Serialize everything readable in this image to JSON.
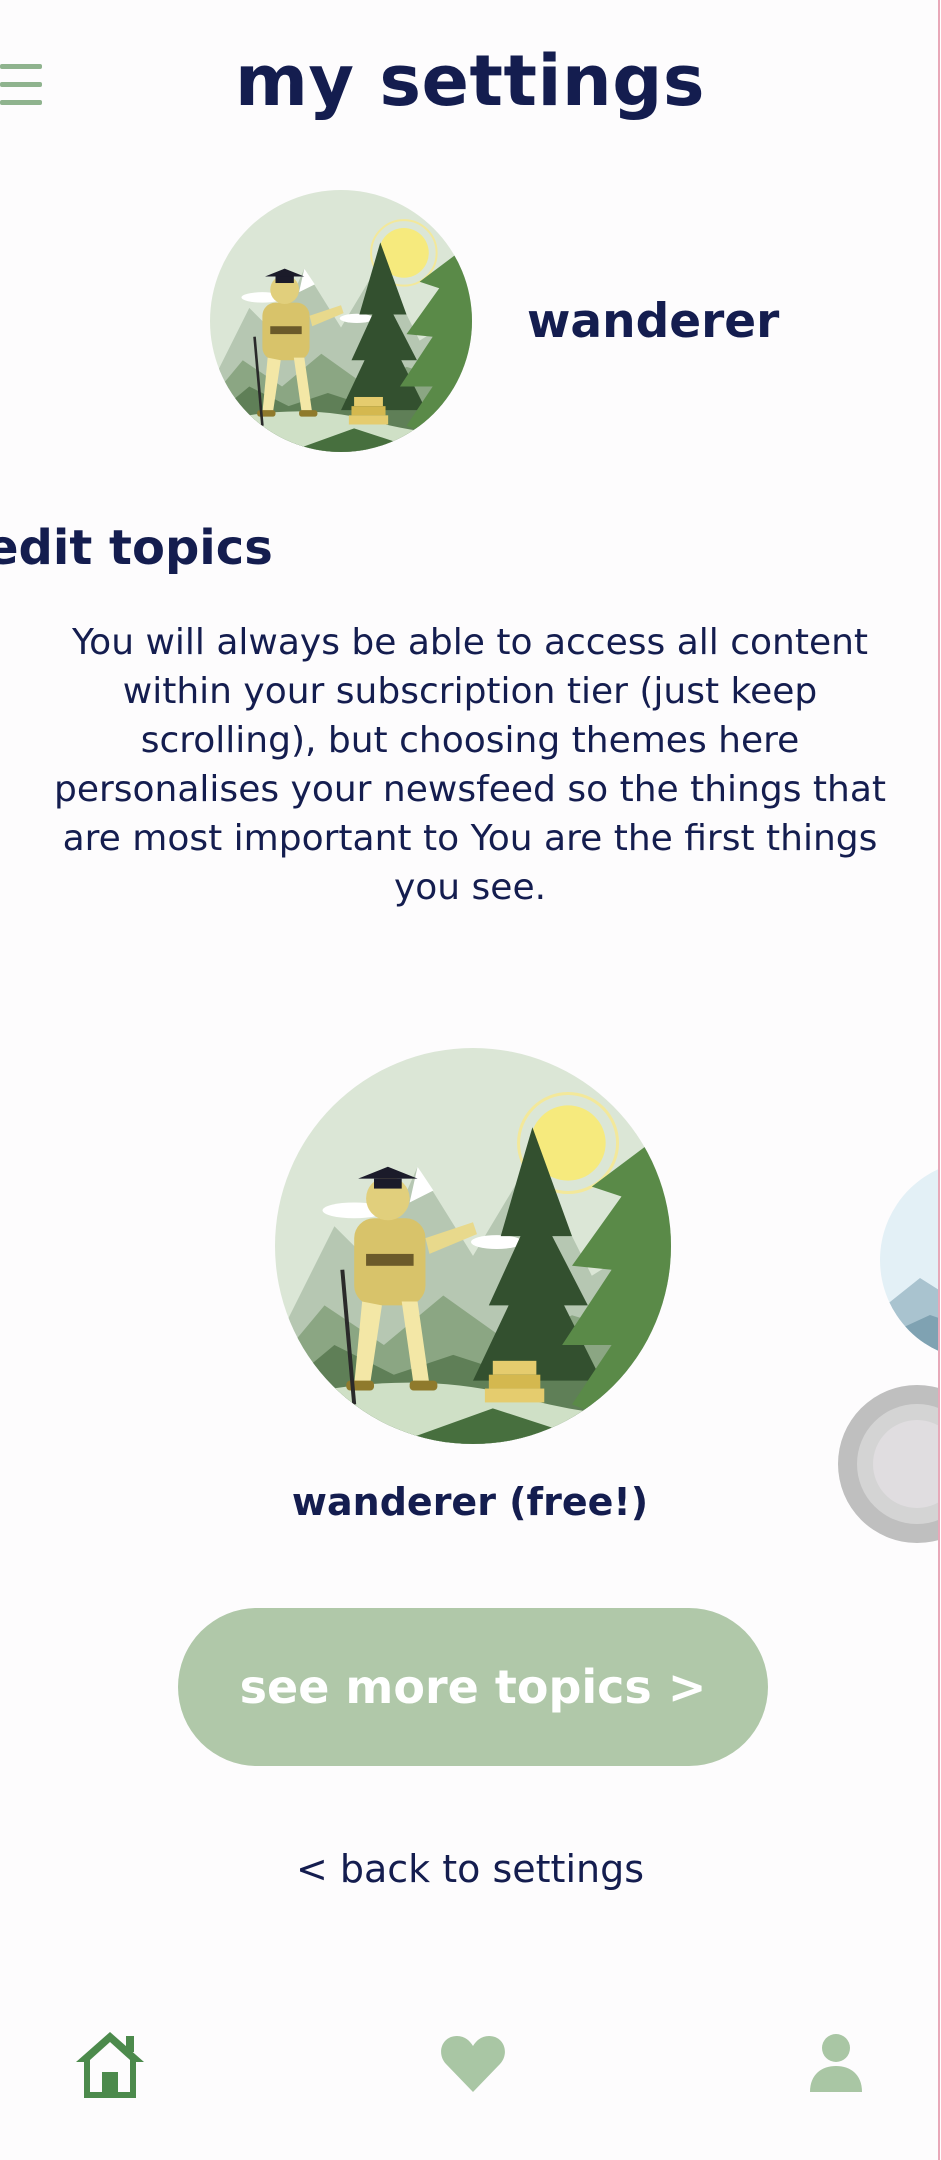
{
  "header": {
    "title": "my settings",
    "menu_icon": "hamburger-menu-icon"
  },
  "profile": {
    "name": "wanderer",
    "avatar": "hiker-mountain-illustration"
  },
  "topics": {
    "heading": "edit topics",
    "intro_lines": [
      "You will always be able to access all content",
      "within your subscription tier (just keep",
      "scrolling), but choosing themes here",
      "personalises your newsfeed so the things that",
      "are most important to You are the first things",
      "you see."
    ],
    "selected_card": {
      "label": "wanderer (free!)",
      "image": "hiker-mountain-illustration"
    },
    "see_more_label": "see more topics >",
    "back_label": "< back to settings"
  },
  "bottom_nav": [
    {
      "name": "home",
      "icon": "home-icon"
    },
    {
      "name": "favorites",
      "icon": "heart-icon"
    },
    {
      "name": "profile",
      "icon": "user-icon"
    }
  ],
  "colors": {
    "navy_text": "#141d4f",
    "sage_green": "#b0c8a9",
    "forest_green": "#4c8a4c",
    "nav_green": "#a9c6a4"
  }
}
